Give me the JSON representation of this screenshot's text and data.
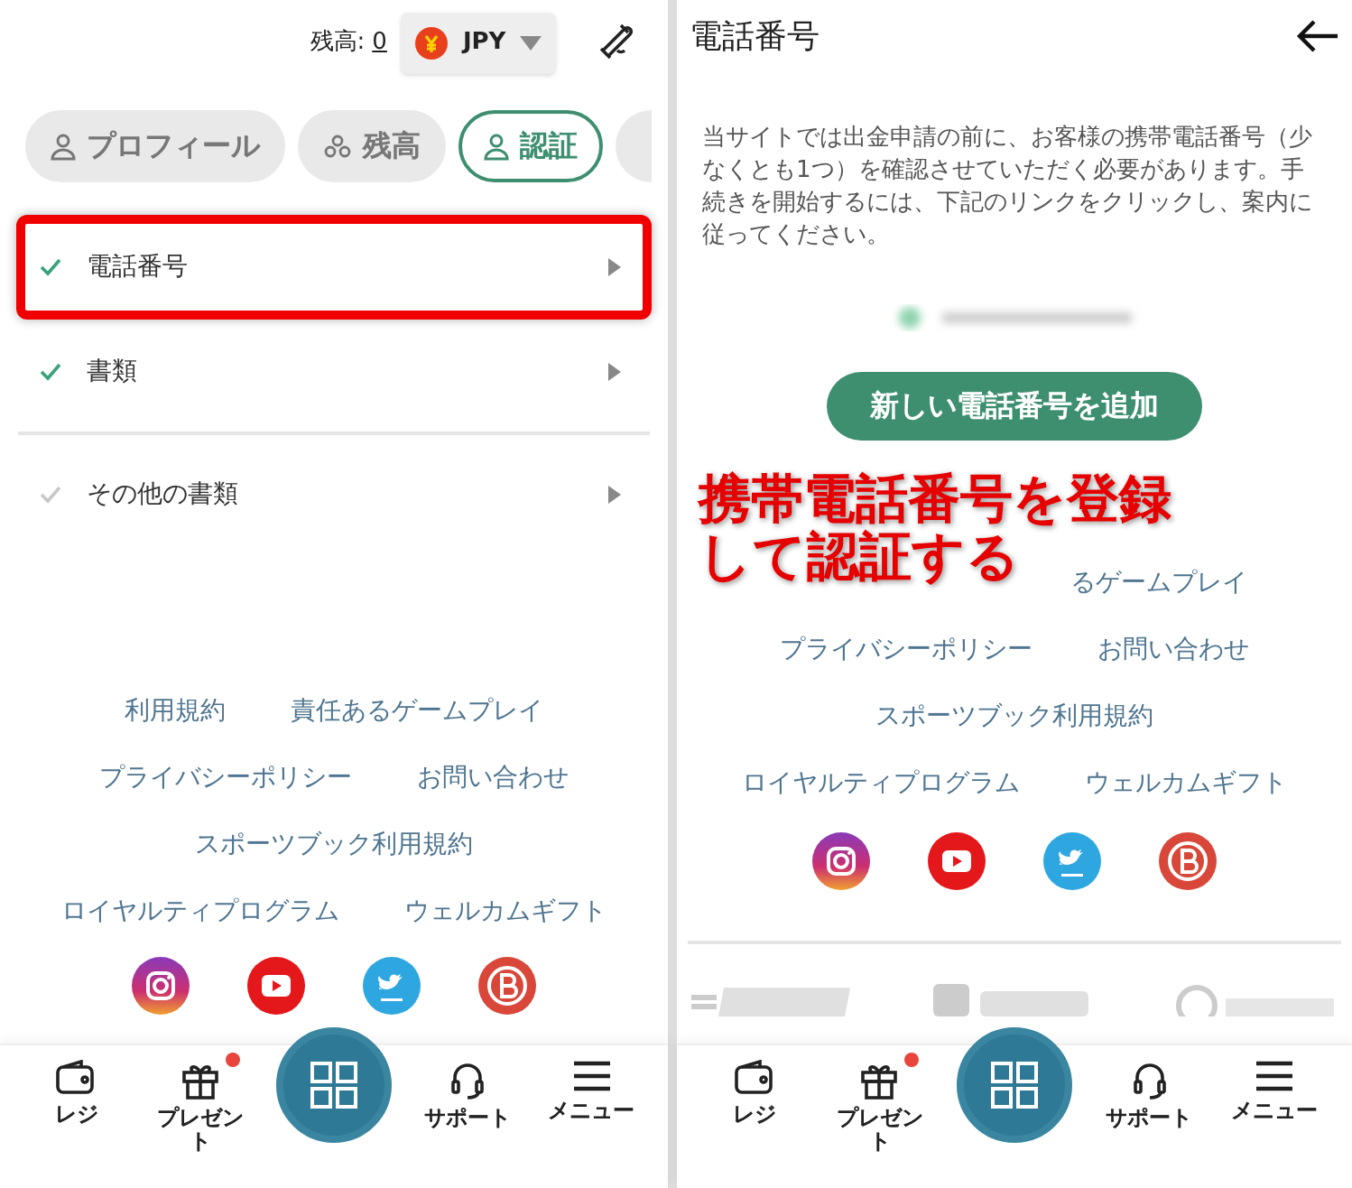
{
  "left": {
    "balance_label": "残高:",
    "balance": "0",
    "currency": "JPY",
    "tabs": [
      {
        "label": "プロフィール",
        "selected": false
      },
      {
        "label": "残高",
        "selected": false
      },
      {
        "label": "認証",
        "selected": true
      }
    ],
    "items": [
      {
        "label": "電話番号",
        "checked": true,
        "highlighted": true
      },
      {
        "label": "書類",
        "checked": true,
        "highlighted": false
      },
      {
        "label": "その他の書類",
        "checked": false,
        "highlighted": false
      }
    ],
    "footer_links": [
      [
        "利用規約",
        "責任あるゲームプレイ"
      ],
      [
        "プライバシーポリシー",
        "お問い合わせ"
      ],
      [
        "スポーツブック利用規約"
      ],
      [
        "ロイヤルティプログラム",
        "ウェルカムギフト"
      ]
    ],
    "nav": [
      {
        "label": "レジ",
        "badge": false
      },
      {
        "label": "プレゼント",
        "badge": true
      },
      {
        "label": "サポート",
        "badge": false
      },
      {
        "label": "メニュー",
        "badge": false
      }
    ]
  },
  "right": {
    "title": "電話番号",
    "description": "当サイトでは出金申請の前に、お客様の携帯電話番号（少なくとも1つ）を確認させていただく必要があります。手続きを開始するには、下記のリンクをクリックし、案内に従ってください。",
    "button": "新しい電話番号を追加",
    "annotation": [
      "携帯電話番号を登録",
      "して認証する"
    ],
    "footer_links": [
      [
        "るゲームプレイ"
      ],
      [
        "プライバシーポリシー",
        "お問い合わせ"
      ],
      [
        "スポーツブック利用規約"
      ],
      [
        "ロイヤルティプログラム",
        "ウェルカムギフト"
      ]
    ],
    "nav": [
      {
        "label": "レジ",
        "badge": false
      },
      {
        "label": "プレゼント",
        "badge": true
      },
      {
        "label": "サポート",
        "badge": false
      },
      {
        "label": "メニュー",
        "badge": false
      }
    ]
  }
}
